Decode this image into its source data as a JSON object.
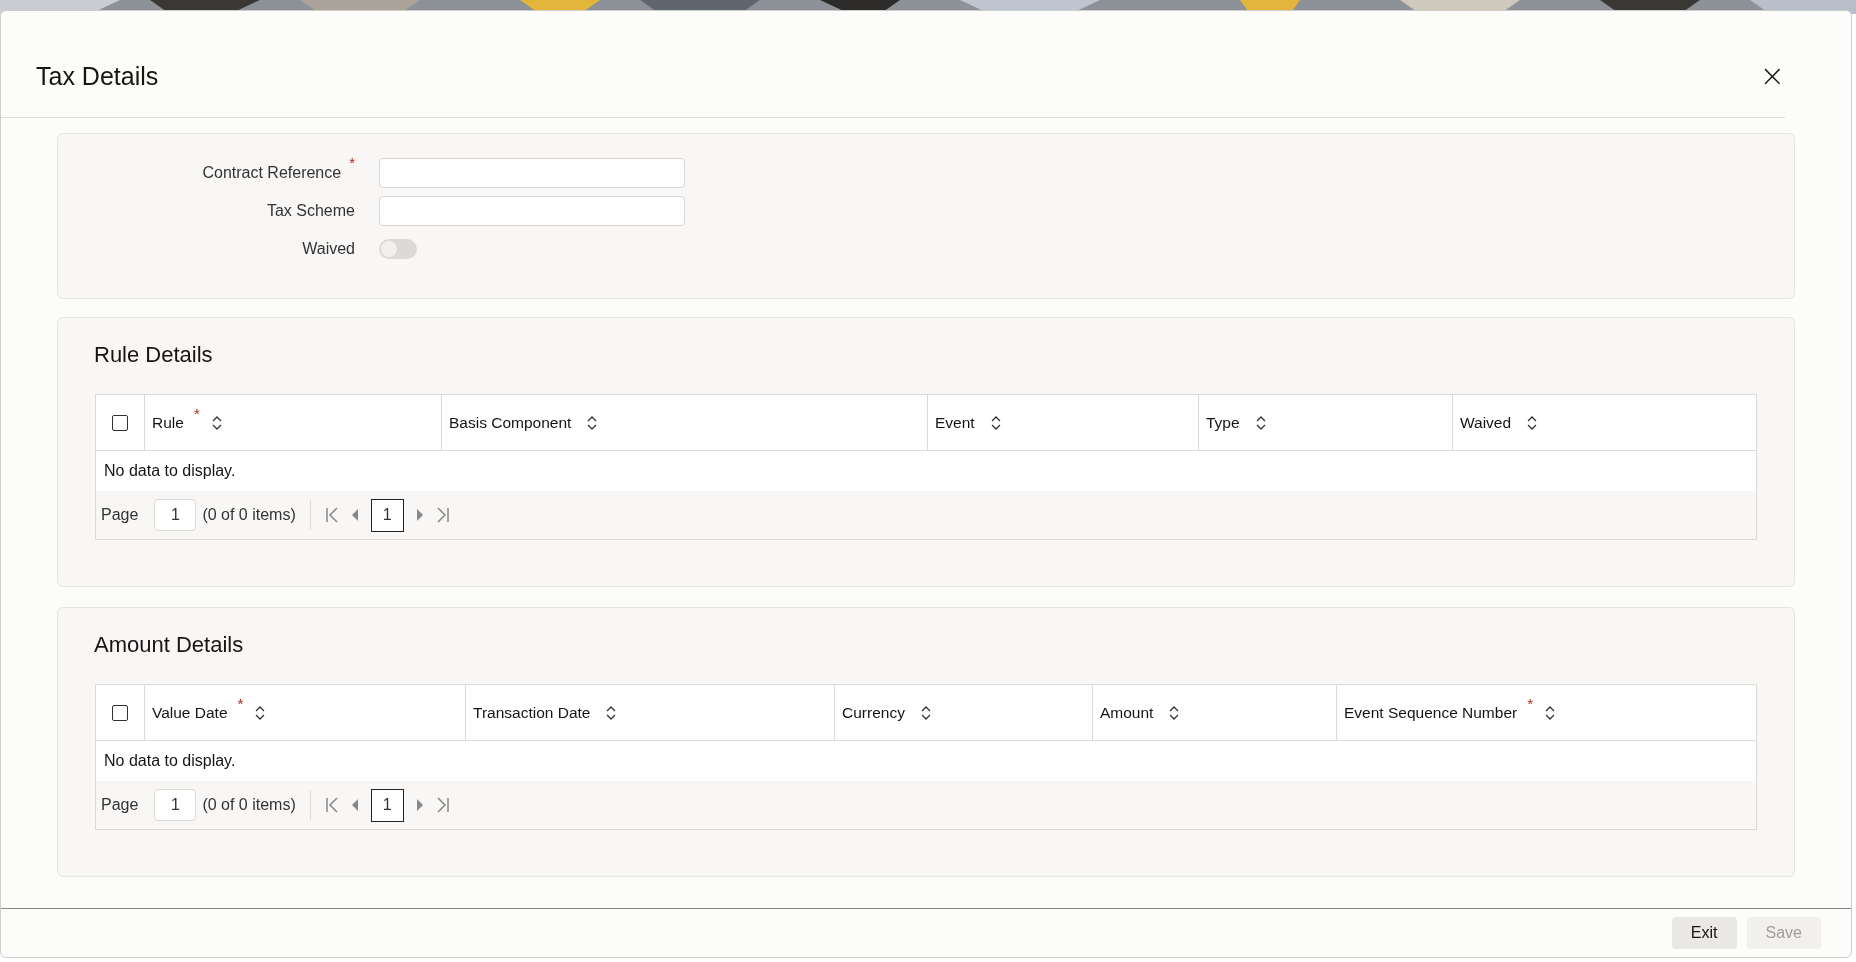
{
  "dialog": {
    "title": "Tax Details",
    "close": "×"
  },
  "form": [
    {
      "kind": "text",
      "label": "Contract Reference",
      "required_mark": "*"
    },
    {
      "kind": "text",
      "label": "Tax Scheme"
    },
    {
      "kind": "switch",
      "label": "Waived",
      "on": false
    }
  ],
  "sections": [
    {
      "title": "Rule Details",
      "select_all": false,
      "columns": [
        {
          "label": "Rule",
          "required_mark": "*"
        },
        {
          "label": "Basis Component"
        },
        {
          "label": "Event"
        },
        {
          "label": "Type"
        },
        {
          "label": "Waived"
        }
      ],
      "empty_message": "No data to display.",
      "pager": {
        "label": "Page",
        "page": "1",
        "summary": "(0 of 0 items)",
        "current": "1"
      }
    },
    {
      "title": "Amount Details",
      "select_all": false,
      "columns": [
        {
          "label": "Value Date",
          "required_mark": "*"
        },
        {
          "label": "Transaction Date"
        },
        {
          "label": "Currency"
        },
        {
          "label": "Amount"
        },
        {
          "label": "Event Sequence Number",
          "required_mark": "*"
        }
      ],
      "empty_message": "No data to display.",
      "pager": {
        "label": "Page",
        "page": "1",
        "summary": "(0 of 0 items)",
        "current": "1"
      }
    }
  ],
  "buttons": [
    {
      "label": "Exit",
      "disabled": false
    },
    {
      "label": "Save",
      "disabled": true
    }
  ]
}
